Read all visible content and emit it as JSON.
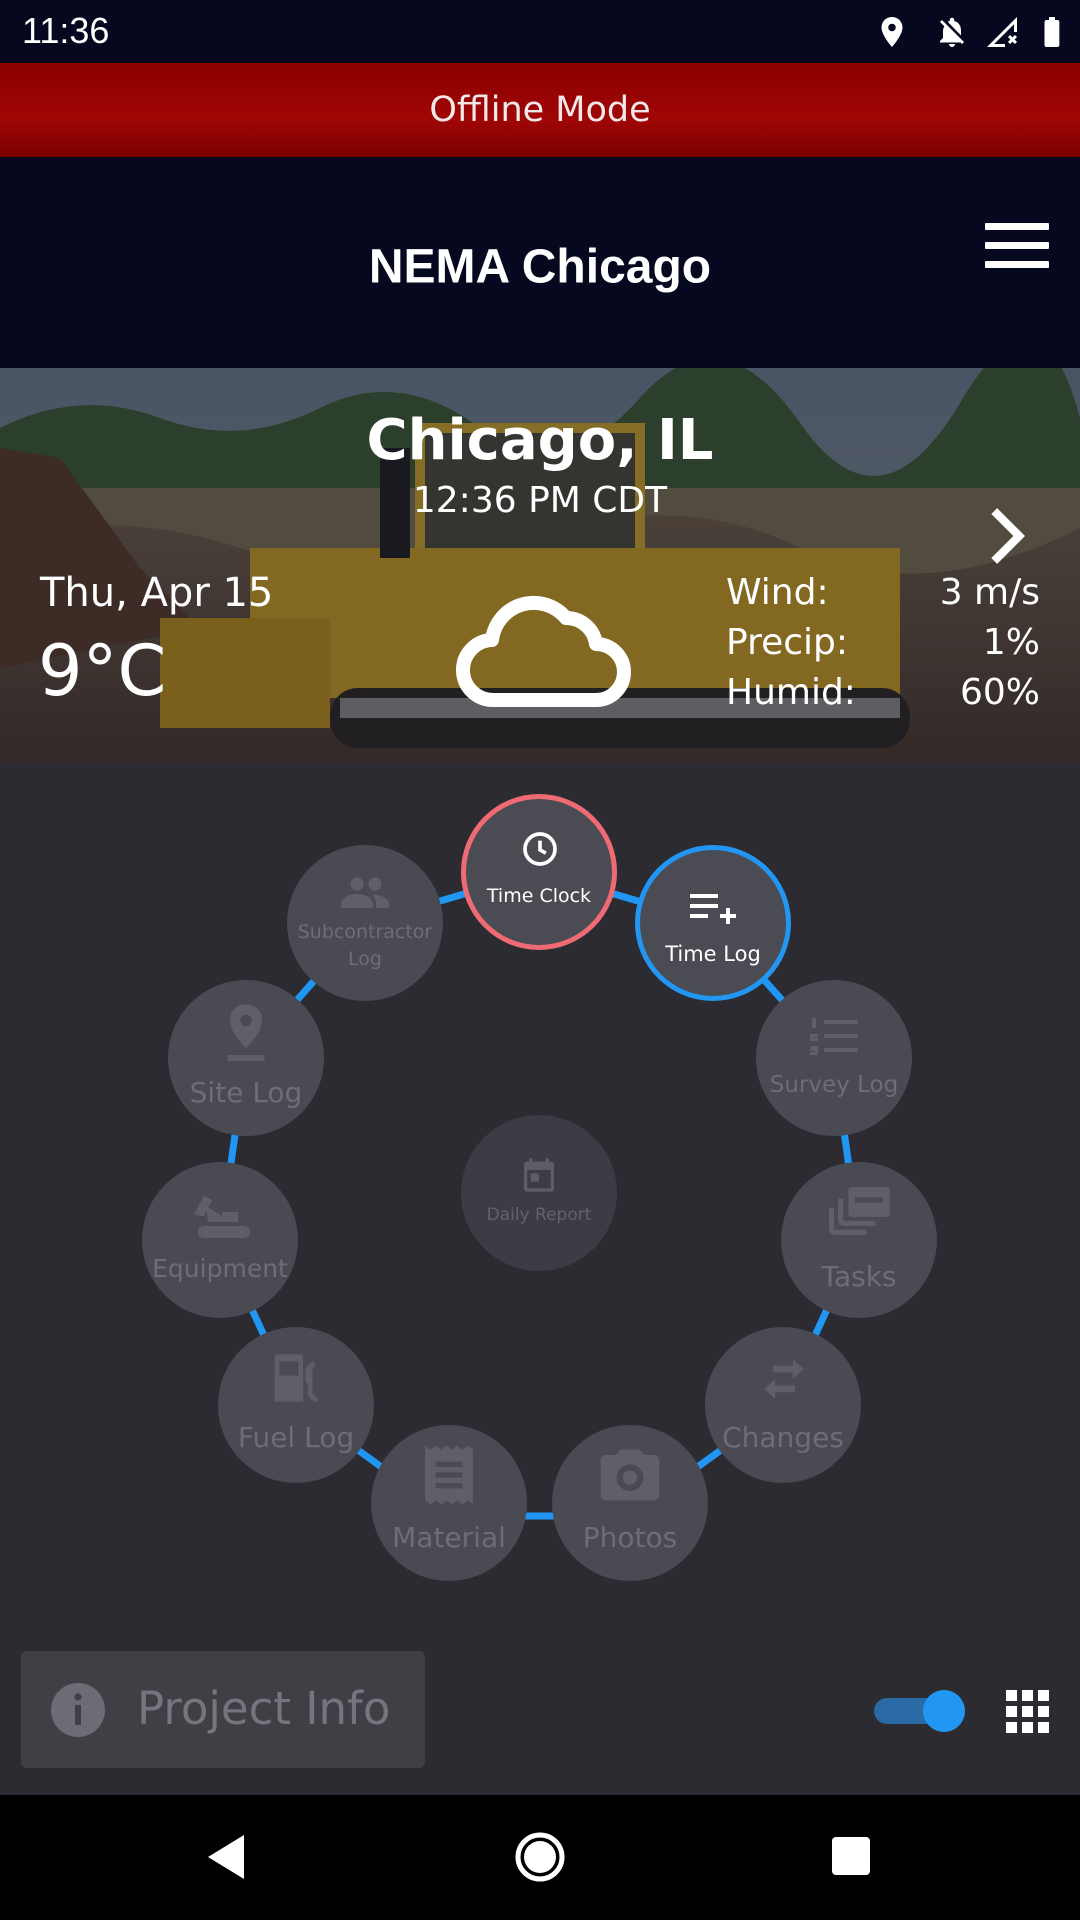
{
  "status_bar": {
    "time": "11:36"
  },
  "banner": {
    "text": "Offline Mode"
  },
  "header": {
    "title": "NEMA Chicago"
  },
  "weather": {
    "city": "Chicago, IL",
    "local_time": "12:36 PM CDT",
    "date": "Thu, Apr 15",
    "temperature": "9°C",
    "condition_icon": "cloud-icon",
    "stats": [
      {
        "label": "Wind:",
        "value": "3 m/s"
      },
      {
        "label": "Precip:",
        "value": "1%"
      },
      {
        "label": "Humid:",
        "value": "60%"
      }
    ]
  },
  "menu": {
    "center": {
      "label": "Daily Report",
      "icon": "calendar-icon"
    },
    "items": [
      {
        "label": "Time Clock",
        "icon": "clock-icon",
        "state": "active-red"
      },
      {
        "label": "Time Log",
        "icon": "playlist-add-icon",
        "state": "active-blue"
      },
      {
        "label": "Survey Log",
        "icon": "numbered-list-icon"
      },
      {
        "label": "Tasks",
        "icon": "layers-icon"
      },
      {
        "label": "Changes",
        "icon": "swap-arrows-icon"
      },
      {
        "label": "Photos",
        "icon": "camera-icon"
      },
      {
        "label": "Material",
        "icon": "receipt-icon"
      },
      {
        "label": "Fuel Log",
        "icon": "fuel-pump-icon"
      },
      {
        "label": "Equipment",
        "icon": "excavator-icon"
      },
      {
        "label": "Site Log",
        "icon": "map-pin-icon"
      },
      {
        "label": "Subcontractor Log",
        "icon": "people-icon"
      }
    ]
  },
  "bottom": {
    "project_info": "Project Info",
    "toggle_on": true
  },
  "colors": {
    "accent_blue": "#2196f3",
    "accent_red": "#ef6b73",
    "banner_red": "#8b0000",
    "header_bg": "#05081f"
  }
}
